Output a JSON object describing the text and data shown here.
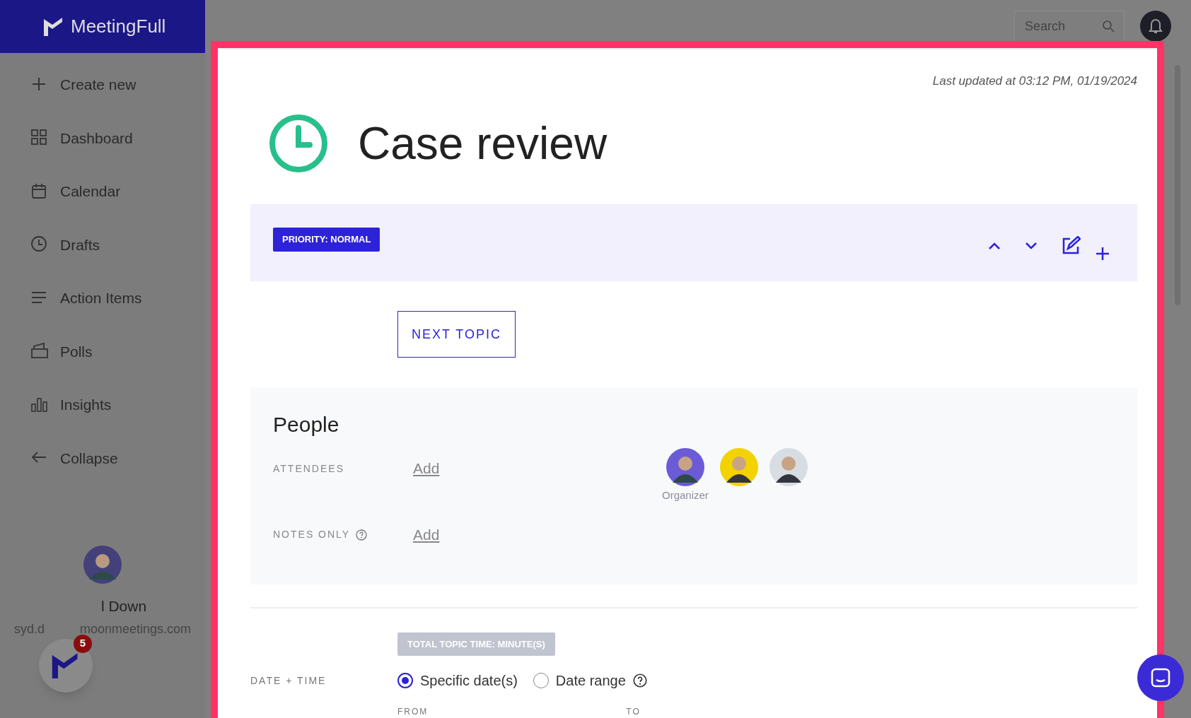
{
  "app": {
    "name": "MeetingFull"
  },
  "sidebar": {
    "items": [
      {
        "kind": "plus",
        "label": "Create new"
      },
      {
        "kind": "grid",
        "label": "Dashboard"
      },
      {
        "kind": "calendar",
        "label": "Calendar"
      },
      {
        "kind": "clock",
        "label": "Drafts"
      },
      {
        "kind": "lines",
        "label": "Action Items"
      },
      {
        "kind": "poll",
        "label": "Polls"
      },
      {
        "kind": "bars",
        "label": "Insights"
      },
      {
        "kind": "arrow",
        "label": "Collapse"
      }
    ],
    "user": {
      "name": "l Down",
      "email_start": "syd.d",
      "email_end": "moonmeetings.com"
    }
  },
  "header": {
    "search": {
      "placeholder": "Search"
    }
  },
  "launcher": {
    "badge": "5"
  },
  "topic": {
    "updated": "Last updated at 03:12 PM, 01/19/2024",
    "title": "Case review",
    "priority": "PRIORITY: NORMAL",
    "next_button": "NEXT TOPIC"
  },
  "people": {
    "title": "People",
    "rows": [
      {
        "label": "ATTENDEES",
        "help": false,
        "action": "Add"
      },
      {
        "label": "NOTES ONLY",
        "help": true,
        "action": "Add"
      }
    ],
    "avatars": [
      {
        "kind": "organizer",
        "caption": "Organizer",
        "color": "#6b5bd6"
      },
      {
        "kind": "person",
        "color": "#f2d200"
      },
      {
        "kind": "person",
        "color": "#d8dde3"
      }
    ]
  },
  "schedule": {
    "total_time": "TOTAL TOPIC TIME: MINUTE(S)",
    "label": "DATE + TIME",
    "options": [
      {
        "label": "Specific date(s)",
        "selected": true,
        "help": false
      },
      {
        "label": "Date range",
        "selected": false,
        "help": true
      }
    ],
    "from_label": "FROM",
    "to_label": "TO"
  }
}
